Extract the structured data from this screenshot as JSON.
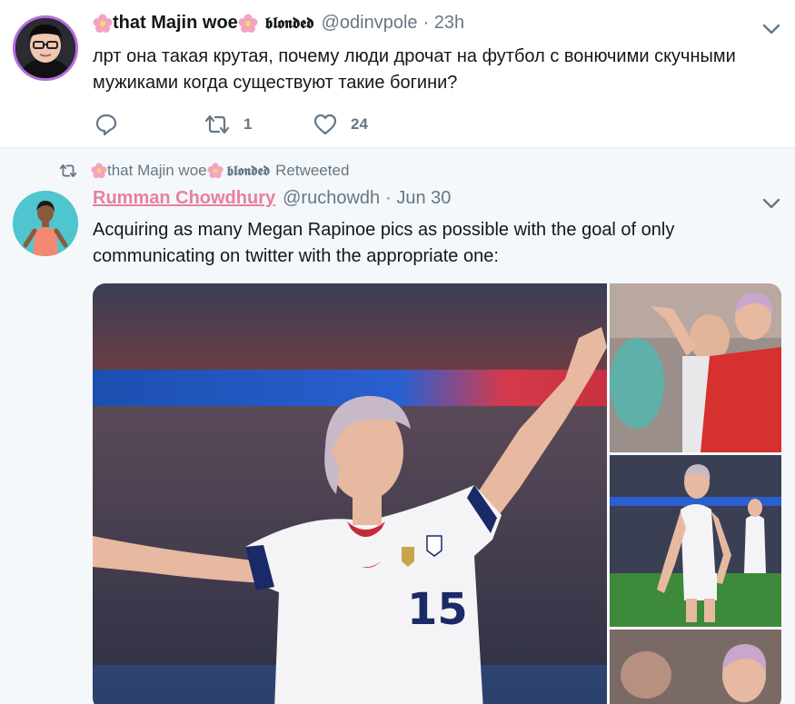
{
  "tweet1": {
    "display_name": "that Majin woe",
    "stylized_suffix": "𝖇𝖑𝖔𝖓𝖉𝖊𝖉",
    "handle": "@odinvpole",
    "time": "· 23h",
    "text": "лрт она такая крутая, почему люди дрочат на футбол с вонючими скучными мужиками когда существуют такие богини?",
    "reply_count": "",
    "retweet_count": "1",
    "like_count": "24"
  },
  "retweet_banner": {
    "name": "that Majin woe",
    "stylized_suffix": "𝖇𝖑𝖔𝖓𝖉𝖊𝖉",
    "label": "Retweeted"
  },
  "tweet2": {
    "display_name": "Rumman Chowdhury",
    "handle": "@ruchowdh",
    "time": "· Jun 30",
    "text": "Acquiring as many Megan Rapinoe pics as possible with the goal of only communicating on twitter with the appropriate one:",
    "jersey_number": "15"
  },
  "colors": {
    "accent_pink": "#e8809c",
    "muted": "#657786",
    "text": "#14171a",
    "background_alt": "#f5f8fa",
    "avatar_border": "#b66dd8"
  },
  "icons": [
    "reply-icon",
    "retweet-icon",
    "like-icon",
    "chevron-down-icon",
    "flower-icon"
  ]
}
